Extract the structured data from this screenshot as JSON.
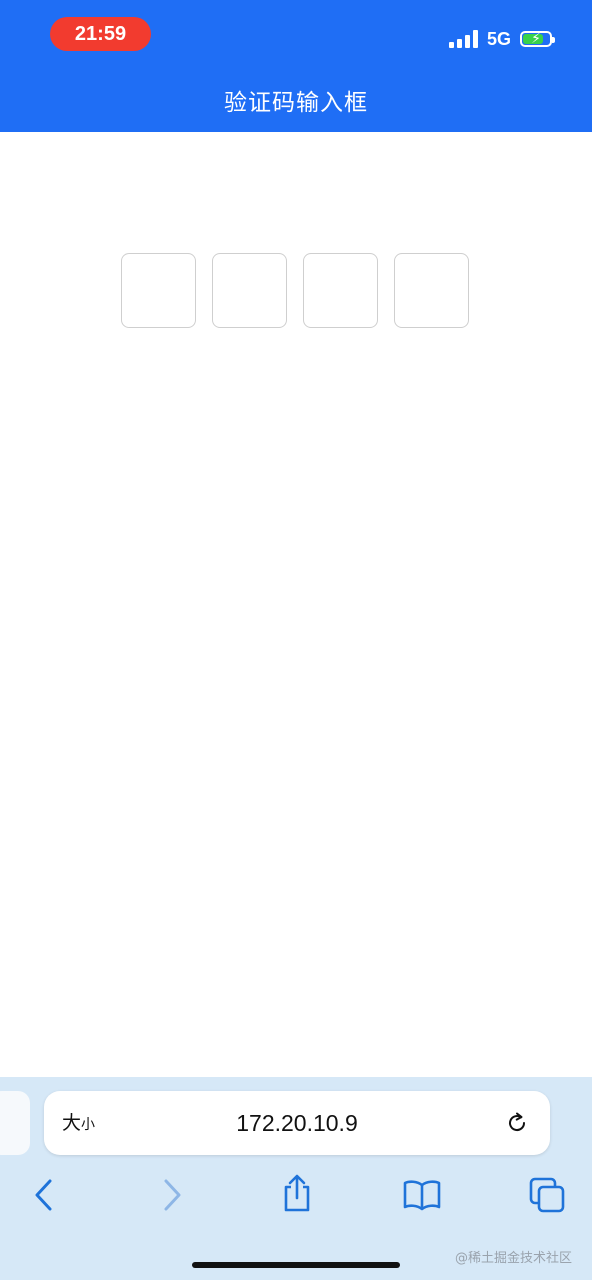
{
  "status_bar": {
    "time": "21:59",
    "network": "5G"
  },
  "header": {
    "title": "验证码输入框"
  },
  "code_input": {
    "digits": [
      "",
      "",
      "",
      ""
    ]
  },
  "browser": {
    "text_size_label_big": "大",
    "text_size_label_small": "小",
    "url": "172.20.10.9"
  },
  "watermark": "@稀土掘金技术社区",
  "colors": {
    "header_bg": "#1f6ef5",
    "time_pill": "#f23b2f",
    "battery": "#38d24a",
    "toolbar_bg": "#d6e8f7",
    "toolbar_icon": "#1f73d9"
  },
  "icons": {
    "reload": "reload-icon",
    "back": "chevron-left-icon",
    "forward": "chevron-right-icon",
    "share": "share-icon",
    "bookmarks": "book-icon",
    "tabs": "tabs-icon"
  }
}
